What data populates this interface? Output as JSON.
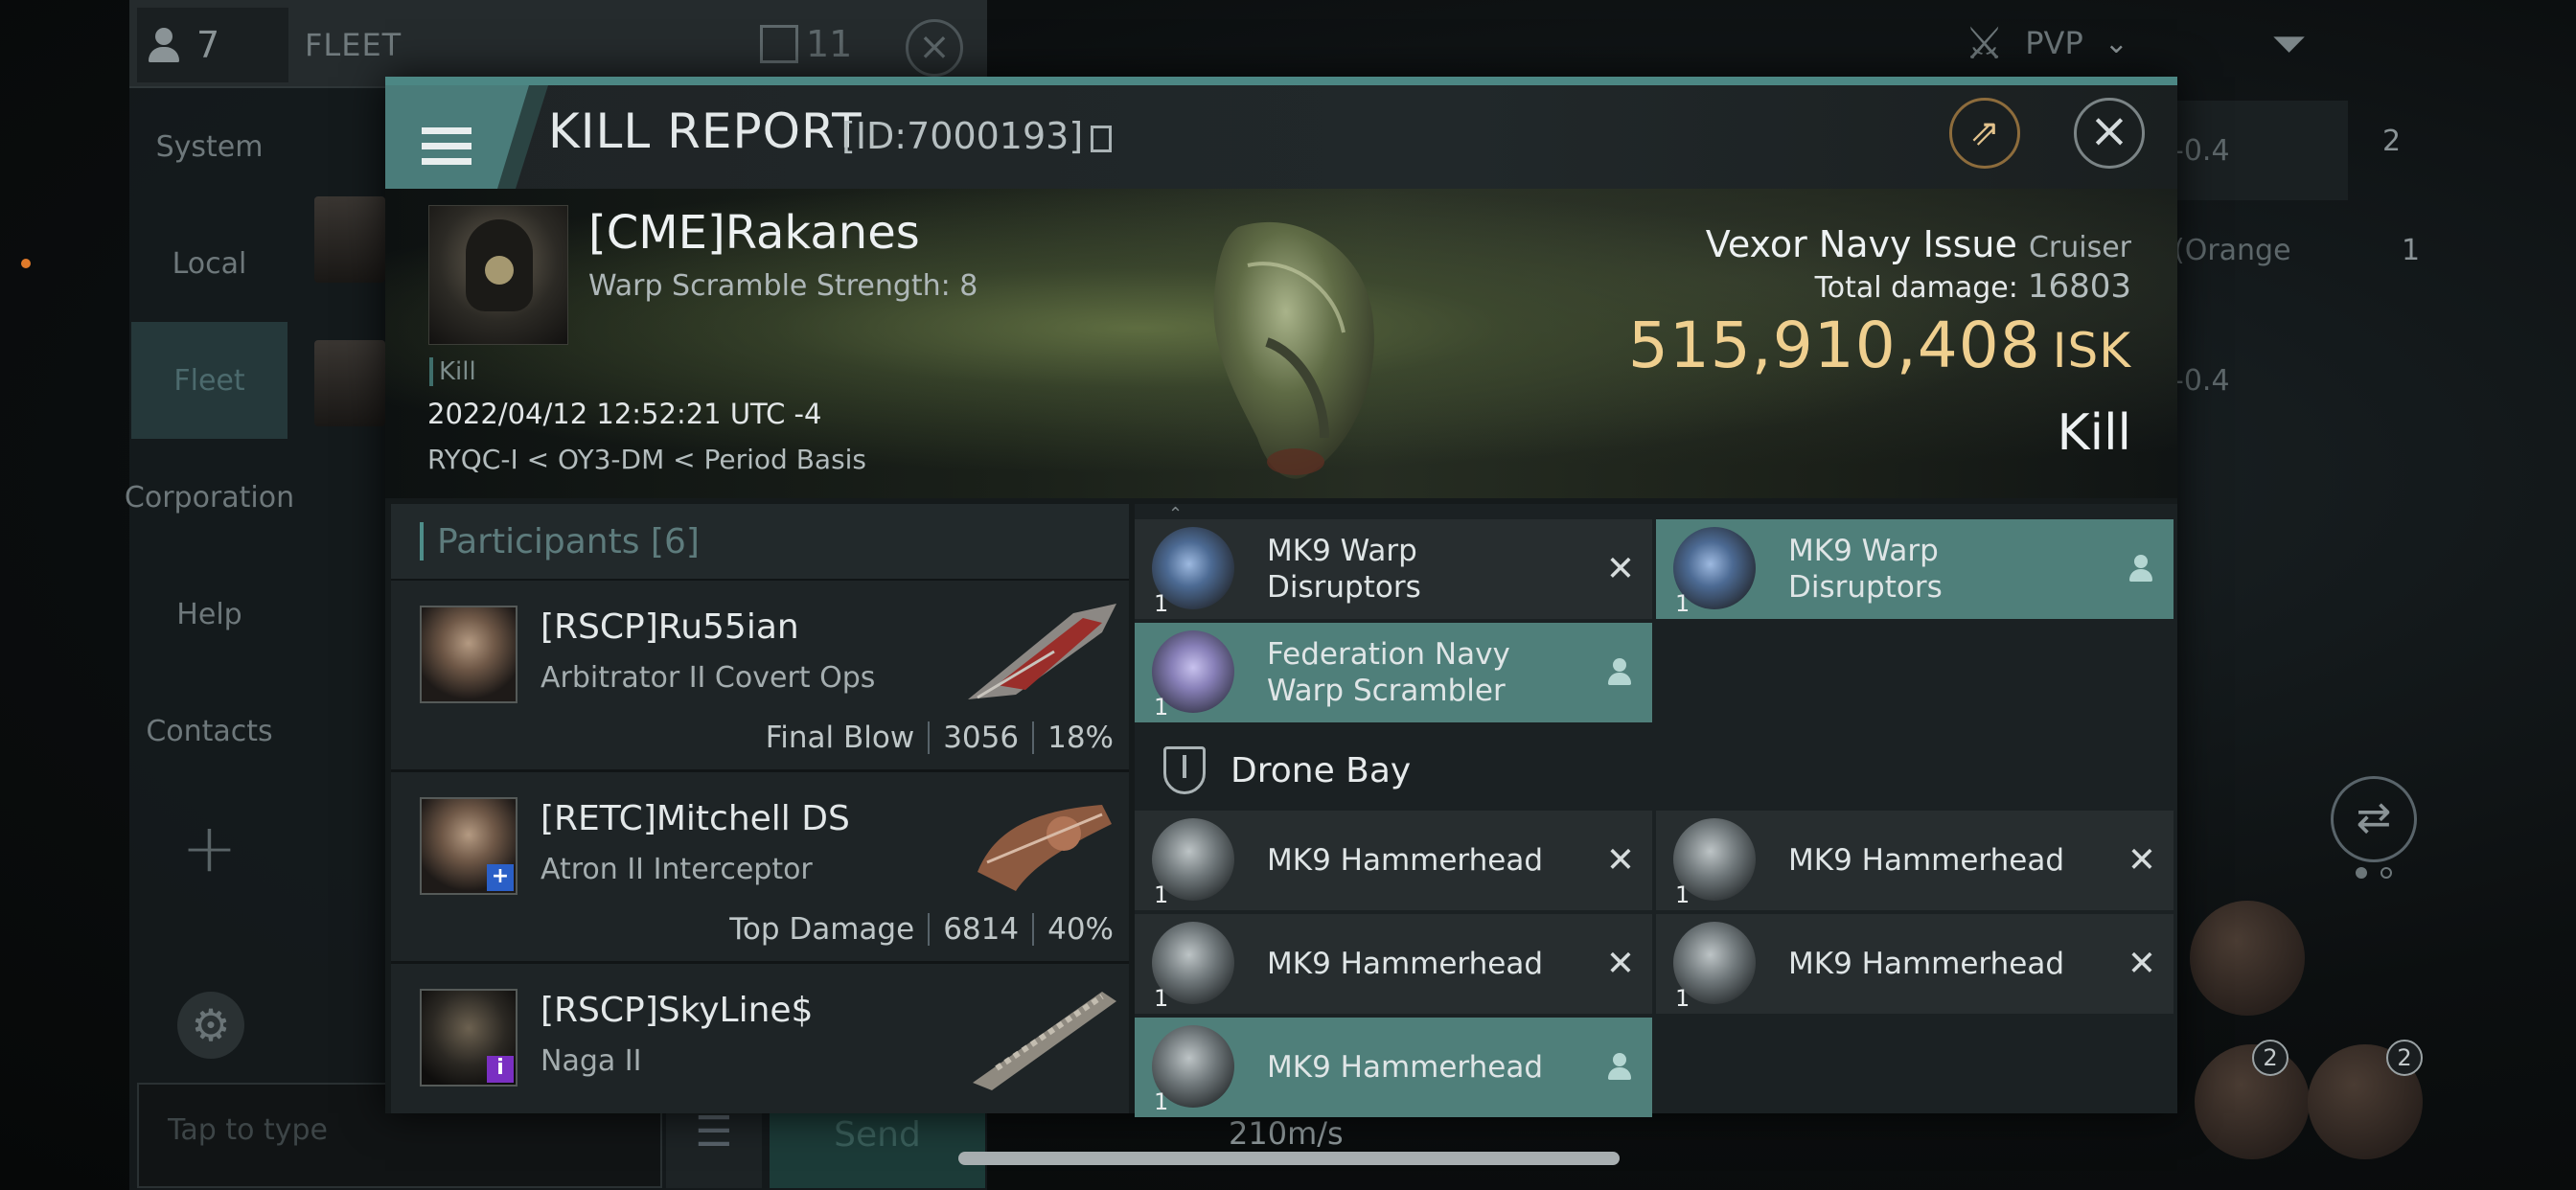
{
  "background": {
    "member_count": "7",
    "fleet_title": "FLEET",
    "fleet_count": "11",
    "nav": [
      "System",
      "Local",
      "Fleet",
      "Corporation",
      "Help",
      "Contacts"
    ],
    "active_nav": "Fleet",
    "chat_placeholder": "Tap to type",
    "send_label": "Send",
    "speed": "210m/s",
    "filter_label": "PVP",
    "overview": [
      {
        "text": "-0.4",
        "extra": "2"
      },
      {
        "text": "(Orange",
        "extra": "1"
      },
      {
        "text": "-0.4",
        "extra": ""
      }
    ],
    "slot_badges": [
      "2",
      "2"
    ]
  },
  "kill_report": {
    "title": "KILL REPORT",
    "id_text": "[ID:7000193]",
    "victim": {
      "name": "[CME]Rakanes",
      "scramble": "Warp Scramble Strength: 8",
      "tag": "Kill",
      "datetime": "2022/04/12 12:52:21 UTC -4",
      "location": "RYQC-I < OY3-DM < Period Basis"
    },
    "ship": {
      "name": "Vexor Navy Issue",
      "class": "Cruiser",
      "total_damage_label": "Total damage:",
      "total_damage": "16803",
      "isk_value": "515,910,408",
      "isk_unit": "ISK",
      "result": "Kill"
    },
    "participants": {
      "label": "Participants",
      "count": "[6]",
      "rows": [
        {
          "name": "[RSCP]Ru55ian",
          "ship": "Arbitrator II Covert Ops",
          "role": "Final Blow",
          "damage": "3056",
          "percent": "18%",
          "badge": ""
        },
        {
          "name": "[RETC]Mitchell DS",
          "ship": "Atron II Interceptor",
          "role": "Top Damage",
          "damage": "6814",
          "percent": "40%",
          "badge": "+"
        },
        {
          "name": "[RSCP]SkyLine$",
          "ship": "Naga II",
          "role": "",
          "damage": "",
          "percent": "",
          "badge": "i"
        }
      ]
    },
    "modules": {
      "items": [
        {
          "name": "MK9 Warp\nDisruptors",
          "qty": "1",
          "state": "destroyed",
          "icon": "blue"
        },
        {
          "name": "MK9 Warp\nDisruptors",
          "qty": "1",
          "state": "dropped",
          "icon": "blue"
        },
        {
          "name": "Federation Navy\nWarp Scrambler",
          "qty": "1",
          "state": "dropped",
          "icon": "purple"
        }
      ],
      "drone_bay_label": "Drone Bay",
      "drones": [
        {
          "name": "MK9  Hammerhead",
          "qty": "1",
          "state": "destroyed"
        },
        {
          "name": "MK9  Hammerhead",
          "qty": "1",
          "state": "destroyed"
        },
        {
          "name": "MK9  Hammerhead",
          "qty": "1",
          "state": "destroyed"
        },
        {
          "name": "MK9  Hammerhead",
          "qty": "1",
          "state": "destroyed"
        },
        {
          "name": "MK9  Hammerhead",
          "qty": "1",
          "state": "dropped"
        }
      ]
    }
  },
  "colors": {
    "accent": "#4f7f7a",
    "isk": "#efcf8f",
    "share_ring": "#8d6c3c"
  }
}
